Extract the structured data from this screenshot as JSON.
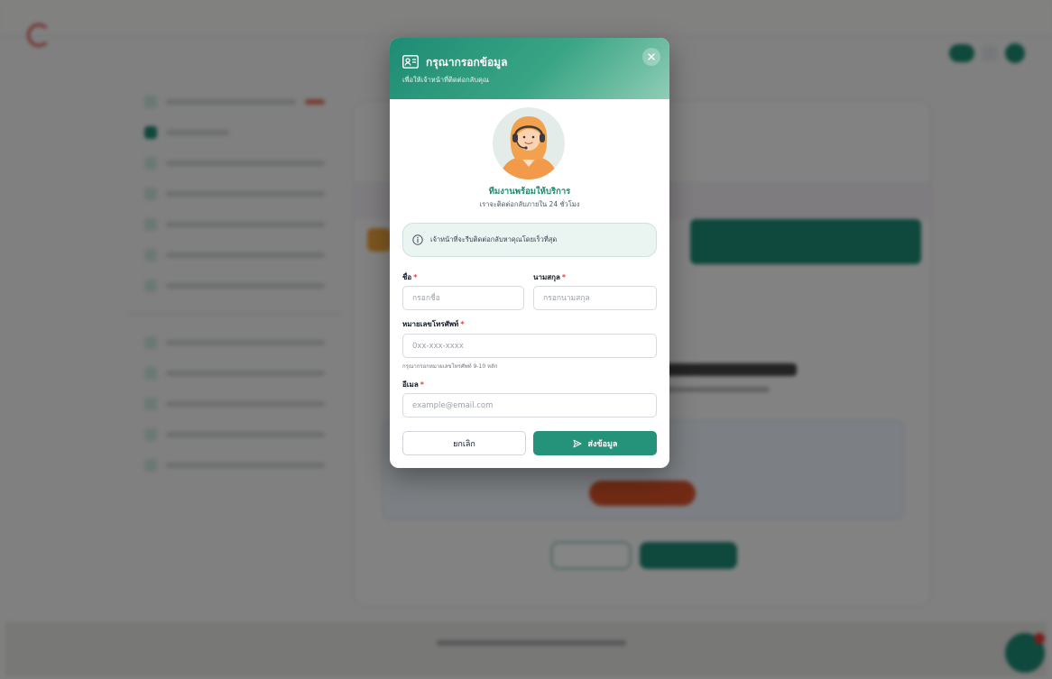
{
  "modal": {
    "title": "กรุณากรอกข้อมูล",
    "subtitle": "เพื่อให้เจ้าหน้าที่ติดต่อกลับคุณ",
    "team_title": "ทีมงานพร้อมให้บริการ",
    "team_subtitle": "เราจะติดต่อกลับภายใน 24 ชั่วโมง",
    "info_text": "เจ้าหน้าที่จะรีบติดต่อกลับหาคุณโดยเร็วที่สุด",
    "fields": {
      "first_name": {
        "label": "ชื่อ",
        "required_mark": "*",
        "placeholder": "กรอกชื่อ",
        "value": ""
      },
      "last_name": {
        "label": "นามสกุล",
        "required_mark": "*",
        "placeholder": "กรอกนามสกุล",
        "value": ""
      },
      "phone": {
        "label": "หมายเลขโทรศัพท์",
        "required_mark": "*",
        "placeholder": "0xx-xxx-xxxx",
        "value": "",
        "hint": "กรุณากรอกหมายเลขโทรศัพท์ 9-10 หลัก"
      },
      "email": {
        "label": "อีเมล",
        "required_mark": "*",
        "placeholder": "example@email.com",
        "value": ""
      }
    },
    "buttons": {
      "cancel": "ยกเลิก",
      "submit": "ส่งข้อมูล"
    },
    "icons": {
      "header": "contact-card-icon",
      "close": "close-icon",
      "info": "info-icon",
      "submit": "send-icon",
      "avatar": "support-agent-avatar"
    }
  },
  "colors": {
    "primary": "#25927a",
    "header_gradient_start": "#1e8c74",
    "header_gradient_end": "#8fcdb6",
    "required": "#e53935",
    "info_bg": "#eaf4f1"
  }
}
